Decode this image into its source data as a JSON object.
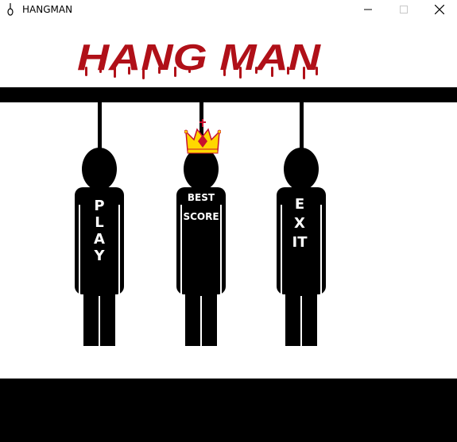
{
  "window": {
    "title": "HANGMAN",
    "app_icon": "noose-icon",
    "controls": [
      "minimize-icon",
      "maximize-icon",
      "close-icon"
    ]
  },
  "logo": {
    "text": "HANG MAN",
    "color": "#b01018"
  },
  "menu": {
    "play": {
      "label": "PLAY"
    },
    "best_score": {
      "label_line1": "BEST",
      "label_line2": "SCORE",
      "icon": "crown-icon"
    },
    "exit": {
      "label": "EXIT"
    }
  },
  "colors": {
    "crown_gold": "#ffd700",
    "crown_red": "#c8102e",
    "figure": "#000000",
    "background": "#ffffff"
  }
}
